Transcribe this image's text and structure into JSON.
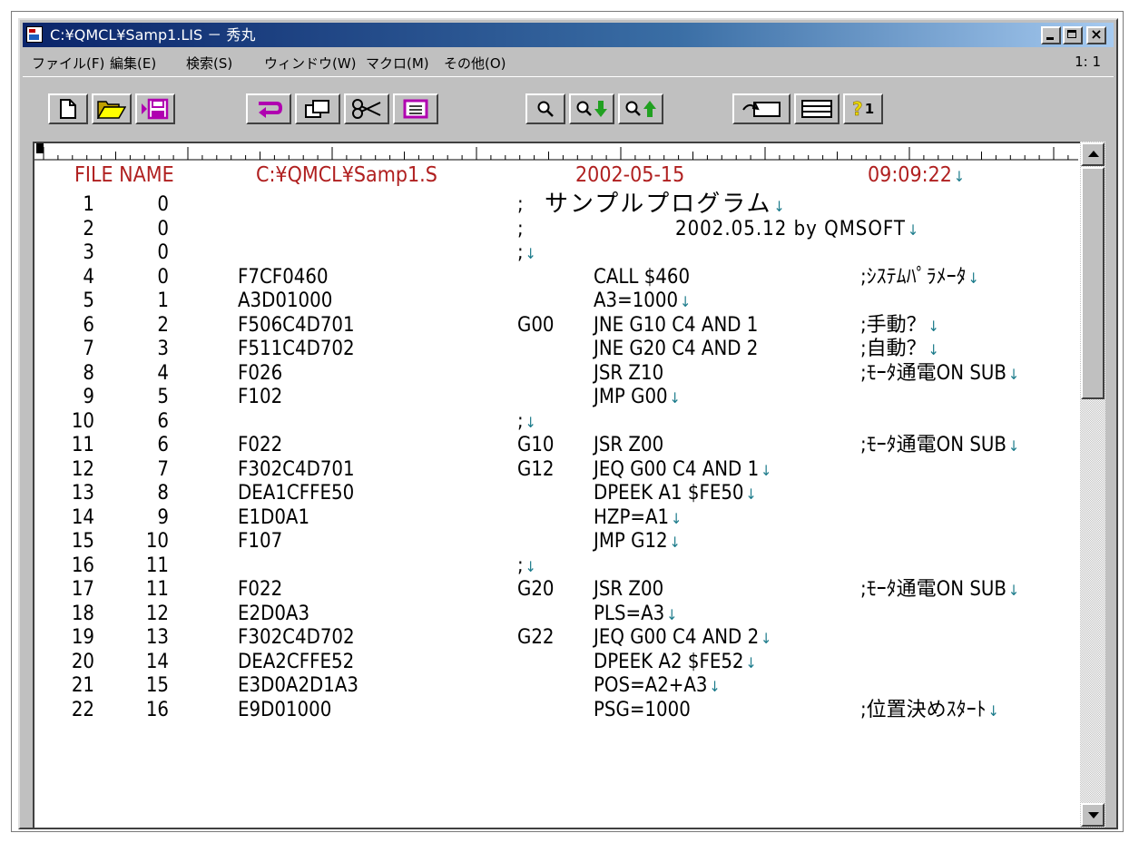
{
  "window": {
    "title": "C:¥QMCL¥Samp1.LIS － 秀丸",
    "close_glyph": "×"
  },
  "menu": {
    "items": [
      "ファイル(F)",
      "編集(E)",
      "検索(S)",
      "ウィンドウ(W)",
      "マクロ(M)",
      "その他(O)"
    ],
    "cursor_position": "1: 1"
  },
  "toolbar": {
    "buttons": [
      "new-file-icon",
      "open-folder-icon",
      "save-icon",
      "undo-icon",
      "copy-icon",
      "cut-icon",
      "paste-icon",
      "search-icon",
      "search-down-icon",
      "search-up-icon",
      "grep-icon",
      "split-window-icon",
      "help-icon"
    ],
    "help_label": "1",
    "accent_color": "#b000b0",
    "arrow_green": "#20a020",
    "folder_yellow": "#ffff00"
  },
  "listing": {
    "header": {
      "file_label": "FILE NAME",
      "file_path": "C:¥QMCL¥Samp1.S",
      "date": "2002-05-15",
      "time": "09:09:22",
      "color": "#b02020"
    },
    "newline_marker": "↓",
    "lines": [
      {
        "num": "1",
        "addr": "0",
        "hex": "",
        "label": ";",
        "code": "サンプルプログラム",
        "comment": "",
        "nl": "code"
      },
      {
        "num": "2",
        "addr": "0",
        "hex": "",
        "label": ";",
        "code": "2002.05.12 by QMSOFT",
        "comment": "",
        "nl": "code"
      },
      {
        "num": "3",
        "addr": "0",
        "hex": "",
        "label": ";",
        "code": "",
        "comment": "",
        "nl": "label"
      },
      {
        "num": "4",
        "addr": "0",
        "hex": "F7CF0460",
        "label": "",
        "code": "CALL $460",
        "comment": ";ｼｽﾃﾑﾊﾟﾗﾒｰﾀ",
        "nl": "comment"
      },
      {
        "num": "5",
        "addr": "1",
        "hex": "A3D01000",
        "label": "",
        "code": "A3=1000",
        "comment": "",
        "nl": "code"
      },
      {
        "num": "6",
        "addr": "2",
        "hex": "F506C4D701",
        "label": "G00",
        "code": "JNE G10 C4 AND 1",
        "comment": ";手動？",
        "nl": "comment"
      },
      {
        "num": "7",
        "addr": "3",
        "hex": "F511C4D702",
        "label": "",
        "code": "JNE G20 C4 AND 2",
        "comment": ";自動？",
        "nl": "comment"
      },
      {
        "num": "8",
        "addr": "4",
        "hex": "F026",
        "label": "",
        "code": "JSR Z10",
        "comment": ";ﾓｰﾀ通電ON SUB",
        "nl": "comment"
      },
      {
        "num": "9",
        "addr": "5",
        "hex": "F102",
        "label": "",
        "code": "JMP G00",
        "comment": "",
        "nl": "code"
      },
      {
        "num": "10",
        "addr": "6",
        "hex": "",
        "label": ";",
        "code": "",
        "comment": "",
        "nl": "label"
      },
      {
        "num": "11",
        "addr": "6",
        "hex": "F022",
        "label": "G10",
        "code": "JSR Z00",
        "comment": ";ﾓｰﾀ通電ON SUB",
        "nl": "comment"
      },
      {
        "num": "12",
        "addr": "7",
        "hex": "F302C4D701",
        "label": "G12",
        "code": "JEQ G00 C4 AND 1",
        "comment": "",
        "nl": "code"
      },
      {
        "num": "13",
        "addr": "8",
        "hex": "DEA1CFFE50",
        "label": "",
        "code": "DPEEK A1 $FE50",
        "comment": "",
        "nl": "code"
      },
      {
        "num": "14",
        "addr": "9",
        "hex": "E1D0A1",
        "label": "",
        "code": "HZP=A1",
        "comment": "",
        "nl": "code"
      },
      {
        "num": "15",
        "addr": "10",
        "hex": "F107",
        "label": "",
        "code": "JMP G12",
        "comment": "",
        "nl": "code"
      },
      {
        "num": "16",
        "addr": "11",
        "hex": "",
        "label": ";",
        "code": "",
        "comment": "",
        "nl": "label"
      },
      {
        "num": "17",
        "addr": "11",
        "hex": "F022",
        "label": "G20",
        "code": "JSR Z00",
        "comment": ";ﾓｰﾀ通電ON SUB",
        "nl": "comment"
      },
      {
        "num": "18",
        "addr": "12",
        "hex": "E2D0A3",
        "label": "",
        "code": "PLS=A3",
        "comment": "",
        "nl": "code"
      },
      {
        "num": "19",
        "addr": "13",
        "hex": "F302C4D702",
        "label": "G22",
        "code": "JEQ G00 C4 AND 2",
        "comment": "",
        "nl": "code"
      },
      {
        "num": "20",
        "addr": "14",
        "hex": "DEA2CFFE52",
        "label": "",
        "code": "DPEEK A2 $FE52",
        "comment": "",
        "nl": "code"
      },
      {
        "num": "21",
        "addr": "15",
        "hex": "E3D0A2D1A3",
        "label": "",
        "code": "POS=A2+A3",
        "comment": "",
        "nl": "code"
      },
      {
        "num": "22",
        "addr": "16",
        "hex": "E9D01000",
        "label": "",
        "code": "PSG=1000",
        "comment": ";位置決めｽﾀｰﾄ",
        "nl": "comment"
      }
    ]
  }
}
